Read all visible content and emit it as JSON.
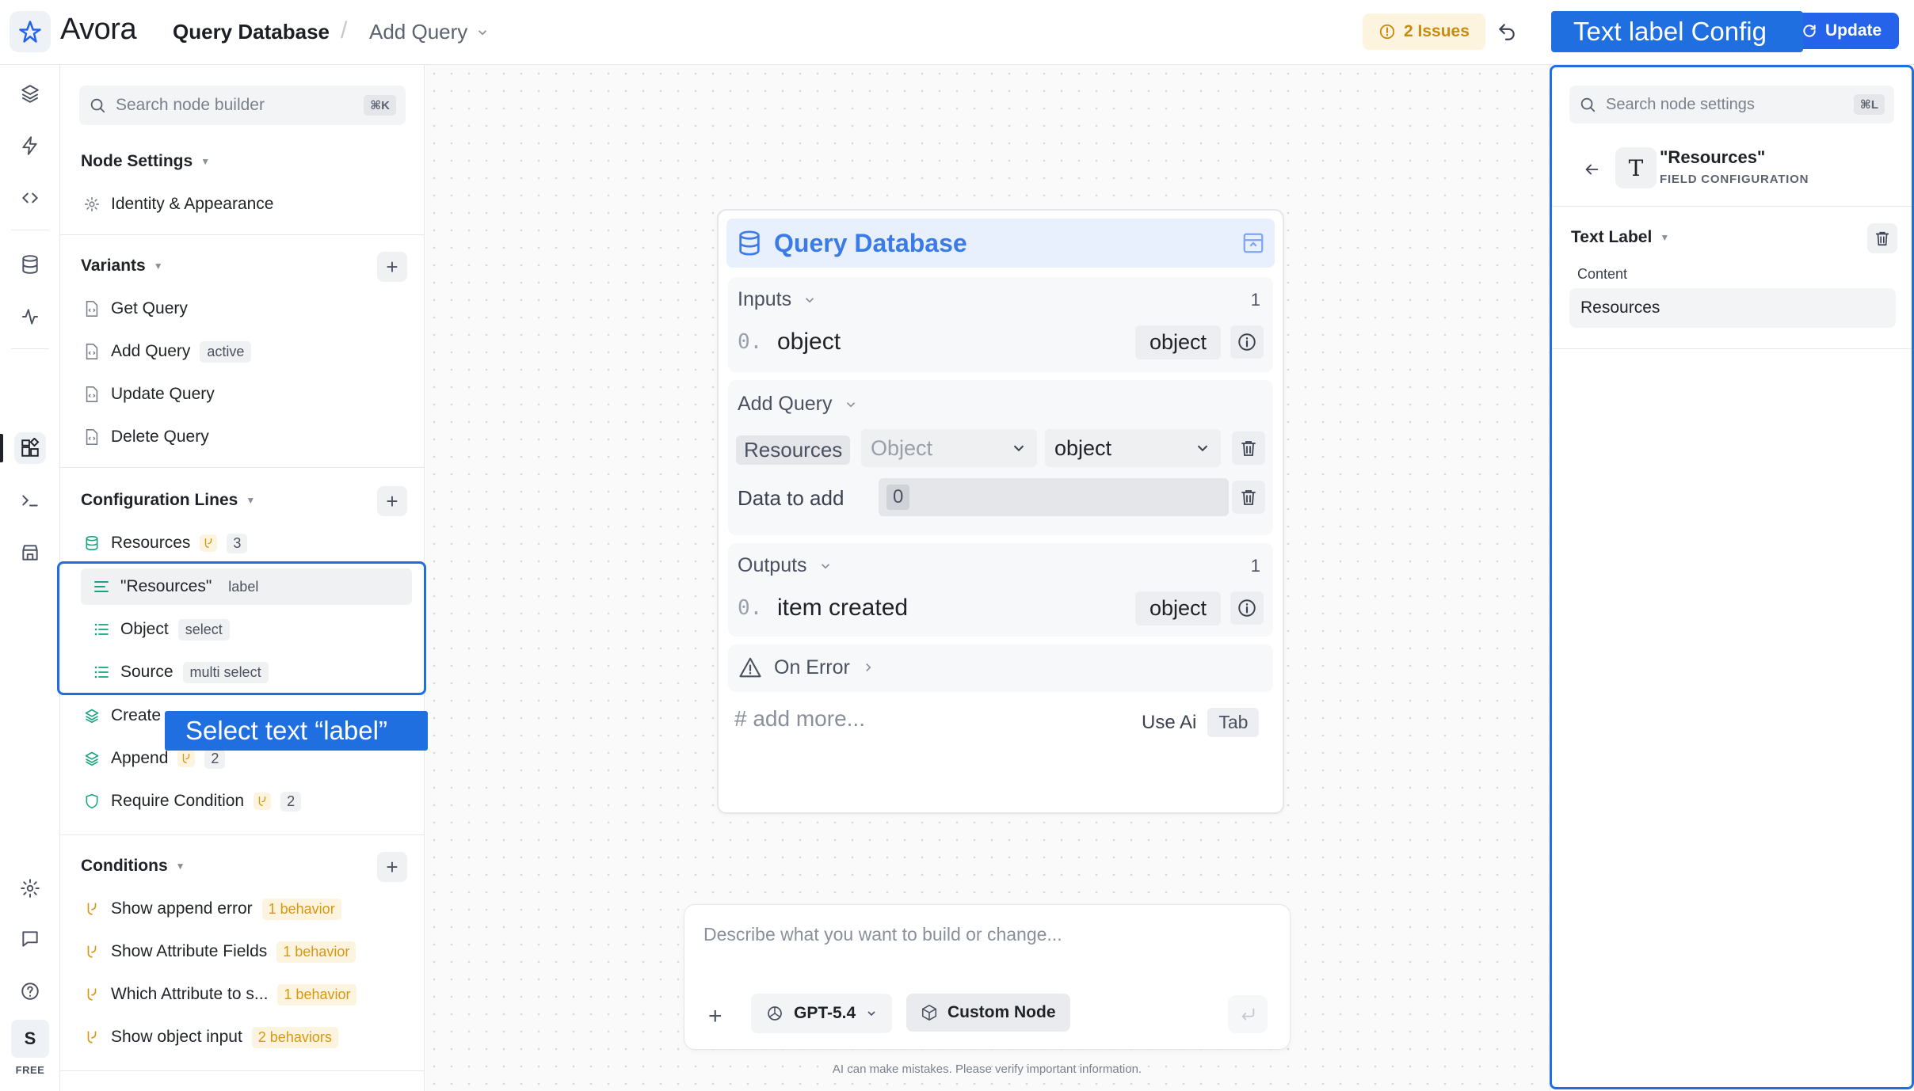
{
  "app": {
    "name": "Avora"
  },
  "header": {
    "breadcrumb_root": "Query Database",
    "breadcrumb_sep": "/",
    "breadcrumb_current": "Add Query",
    "issues": "2 Issues",
    "update": "Update",
    "callout": "Text label Config"
  },
  "rail": {
    "avatar": "S",
    "plan": "FREE"
  },
  "left": {
    "search_placeholder": "Search node builder",
    "search_shortcut": "⌘K",
    "node_settings": {
      "title": "Node Settings",
      "items": [
        "Identity & Appearance"
      ]
    },
    "variants": {
      "title": "Variants",
      "items": [
        {
          "label": "Get Query"
        },
        {
          "label": "Add Query",
          "tag": "active"
        },
        {
          "label": "Update Query"
        },
        {
          "label": "Delete Query"
        }
      ]
    },
    "config_lines": {
      "title": "Configuration Lines",
      "resources": {
        "label": "Resources",
        "count": "3"
      },
      "fields": [
        {
          "label": "\"Resources\"",
          "tag": "label"
        },
        {
          "label": "Object",
          "tag": "select"
        },
        {
          "label": "Source",
          "tag": "multi select"
        }
      ],
      "create": {
        "label": "Create"
      },
      "append": {
        "label": "Append",
        "count": "2"
      },
      "require": {
        "label": "Require Condition",
        "count": "2"
      }
    },
    "conditions": {
      "title": "Conditions",
      "items": [
        {
          "label": "Show append error",
          "behavior": "1 behavior"
        },
        {
          "label": "Show Attribute Fields",
          "behavior": "1 behavior"
        },
        {
          "label": "Which Attribute to s...",
          "behavior": "1 behavior"
        },
        {
          "label": "Show object input",
          "behavior": "2 behaviors"
        }
      ]
    },
    "callout": "Select text “label”"
  },
  "node": {
    "title": "Query Database",
    "inputs": {
      "title": "Inputs",
      "count": "1",
      "index": "0.",
      "name": "object",
      "type": "object"
    },
    "add_query": {
      "title": "Add Query",
      "resources_label": "Resources",
      "object_placeholder": "Object",
      "object_type": "object",
      "data_label": "Data to add",
      "data_value": "0"
    },
    "outputs": {
      "title": "Outputs",
      "count": "1",
      "index": "0.",
      "name": "item created",
      "type": "object"
    },
    "on_error": "On Error",
    "add_more": "# add more...",
    "use_ai": "Use Ai",
    "tab_key": "Tab"
  },
  "prompt": {
    "placeholder": "Describe what you want to build or change...",
    "model": "GPT-5.4",
    "custom": "Custom Node",
    "disclaimer": "AI can make mistakes. Please verify important information."
  },
  "right": {
    "search_placeholder": "Search node settings",
    "search_shortcut": "⌘L",
    "field_name": "\"Resources\"",
    "field_sub": "FIELD CONFIGURATION",
    "section": "Text Label",
    "content_label": "Content",
    "content_value": "Resources"
  },
  "colors": {
    "accent": "#2563eb",
    "callout": "#1f6fe0",
    "warning": "#d9970f",
    "node_title": "#3b7be8",
    "teal": "#16a37f"
  }
}
